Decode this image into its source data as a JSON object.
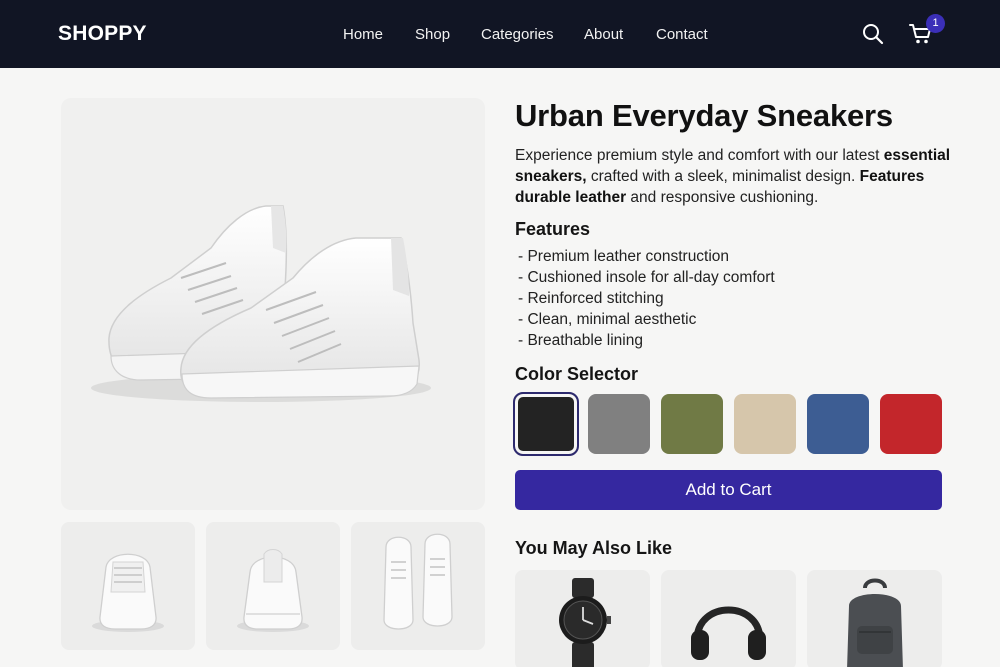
{
  "header": {
    "logo": "SHOPPY",
    "nav": [
      "Home",
      "Shop",
      "Categories",
      "About",
      "Contact"
    ],
    "cart_count": "1"
  },
  "product": {
    "title": "Urban Everyday Sneakers",
    "description": {
      "part1": "Experience premium style and comfort with our latest ",
      "bold1": "essential sneakers,",
      "part2": " crafted with a sleek, minimalist design. ",
      "bold2": "Features durable leather",
      "part3": " and responsive cushioning."
    },
    "features_heading": "Features",
    "features": [
      "Premium leather construction",
      "Cushioned insole for all-day comfort",
      "Reinforced stitching",
      "Clean, minimal aesthetic",
      "Breathable lining"
    ],
    "color_heading": "Color Selector",
    "colors": [
      {
        "name": "black",
        "hex": "#232323",
        "selected": true
      },
      {
        "name": "gray",
        "hex": "#808080",
        "selected": false
      },
      {
        "name": "olive",
        "hex": "#707a45",
        "selected": false
      },
      {
        "name": "beige",
        "hex": "#d6c6ab",
        "selected": false
      },
      {
        "name": "blue",
        "hex": "#3d5d93",
        "selected": false
      },
      {
        "name": "red",
        "hex": "#c3262b",
        "selected": false
      }
    ],
    "add_to_cart": "Add to Cart"
  },
  "related": {
    "heading": "You May Also Like",
    "items": [
      {
        "icon": "watch-icon"
      },
      {
        "icon": "headphones-icon"
      },
      {
        "icon": "backpack-icon"
      }
    ]
  },
  "colors": {
    "header_bg": "#111524",
    "accent": "#3528a0",
    "badge": "#3b2fb8"
  }
}
